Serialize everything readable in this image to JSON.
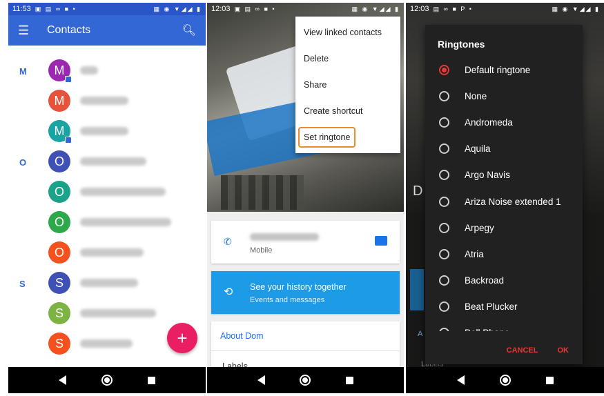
{
  "screen1": {
    "status": {
      "time": "11:53"
    },
    "appbar": {
      "title": "Contacts"
    },
    "section_letters": [
      "M",
      "O",
      "S"
    ],
    "contacts": [
      {
        "initial": "M",
        "color": "#9c27b0",
        "badge": true
      },
      {
        "initial": "M",
        "color": "#e5533d",
        "badge": false
      },
      {
        "initial": "M",
        "color": "#19a3a3",
        "badge": true
      },
      {
        "initial": "O",
        "color": "#3f51b5",
        "badge": false
      },
      {
        "initial": "O",
        "color": "#1aa38a",
        "badge": false
      },
      {
        "initial": "O",
        "color": "#2da84a",
        "badge": false
      },
      {
        "initial": "O",
        "color": "#f4511e",
        "badge": false
      },
      {
        "initial": "S",
        "color": "#3f51b5",
        "badge": false
      },
      {
        "initial": "S",
        "color": "#7cb342",
        "badge": false
      },
      {
        "initial": "S",
        "color": "#f4511e",
        "badge": false
      }
    ],
    "fab_label": "+"
  },
  "screen2": {
    "status": {
      "time": "12:03"
    },
    "menu": [
      "View linked contacts",
      "Delete",
      "Share",
      "Create shortcut",
      "Set ringtone"
    ],
    "highlighted_menu_item": "Set ringtone",
    "phone_type": "Mobile",
    "history": {
      "title": "See your history together",
      "subtitle": "Events and messages"
    },
    "about": "About Dom",
    "labels": "Labels"
  },
  "screen3": {
    "status": {
      "time": "12:03"
    },
    "background_letter": "D",
    "background_about": "A",
    "background_labels": "Labels",
    "dialog": {
      "title": "Ringtones",
      "options": [
        "Default ringtone",
        "None",
        "Andromeda",
        "Aquila",
        "Argo Navis",
        "Ariza Noise extended 1",
        "Arpegy",
        "Atria",
        "Backroad",
        "Beat Plucker",
        "Bell Phone"
      ],
      "selected": "Default ringtone",
      "cancel": "CANCEL",
      "ok": "OK"
    }
  },
  "colors": {
    "appbar": "#3367d6",
    "fab": "#e91e63",
    "accent_red": "#e53935",
    "history_card": "#1e9be6",
    "highlight_outline": "#f08a24"
  }
}
